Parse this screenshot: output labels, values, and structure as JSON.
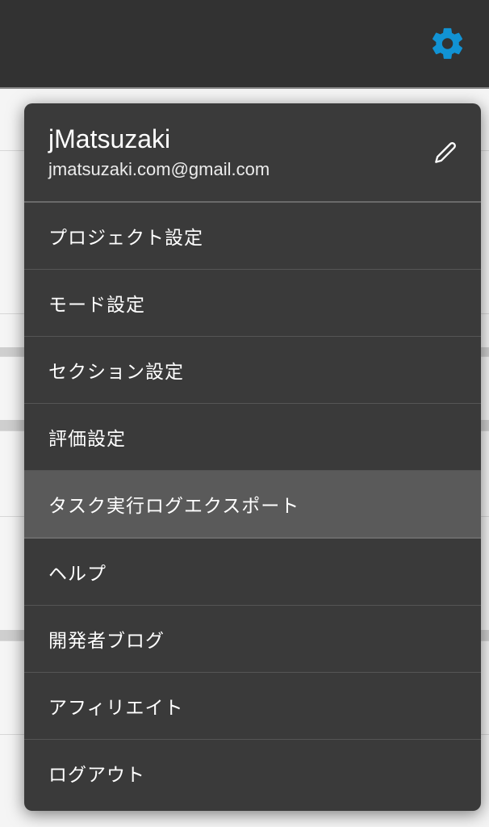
{
  "profile": {
    "name": "jMatsuzaki",
    "email": "jmatsuzaki.com@gmail.com"
  },
  "menu": {
    "items": [
      {
        "label": "プロジェクト設定",
        "highlighted": false
      },
      {
        "label": "モード設定",
        "highlighted": false
      },
      {
        "label": "セクション設定",
        "highlighted": false
      },
      {
        "label": "評価設定",
        "highlighted": false
      },
      {
        "label": "タスク実行ログエクスポート",
        "highlighted": true
      },
      {
        "label": "ヘルプ",
        "highlighted": false
      },
      {
        "label": "開発者ブログ",
        "highlighted": false
      },
      {
        "label": "アフィリエイト",
        "highlighted": false
      },
      {
        "label": "ログアウト",
        "highlighted": false
      }
    ]
  },
  "colors": {
    "accent": "#1193d4",
    "panel": "#3a3a3a",
    "topbar": "#323232",
    "highlight": "#5a5a5a"
  }
}
